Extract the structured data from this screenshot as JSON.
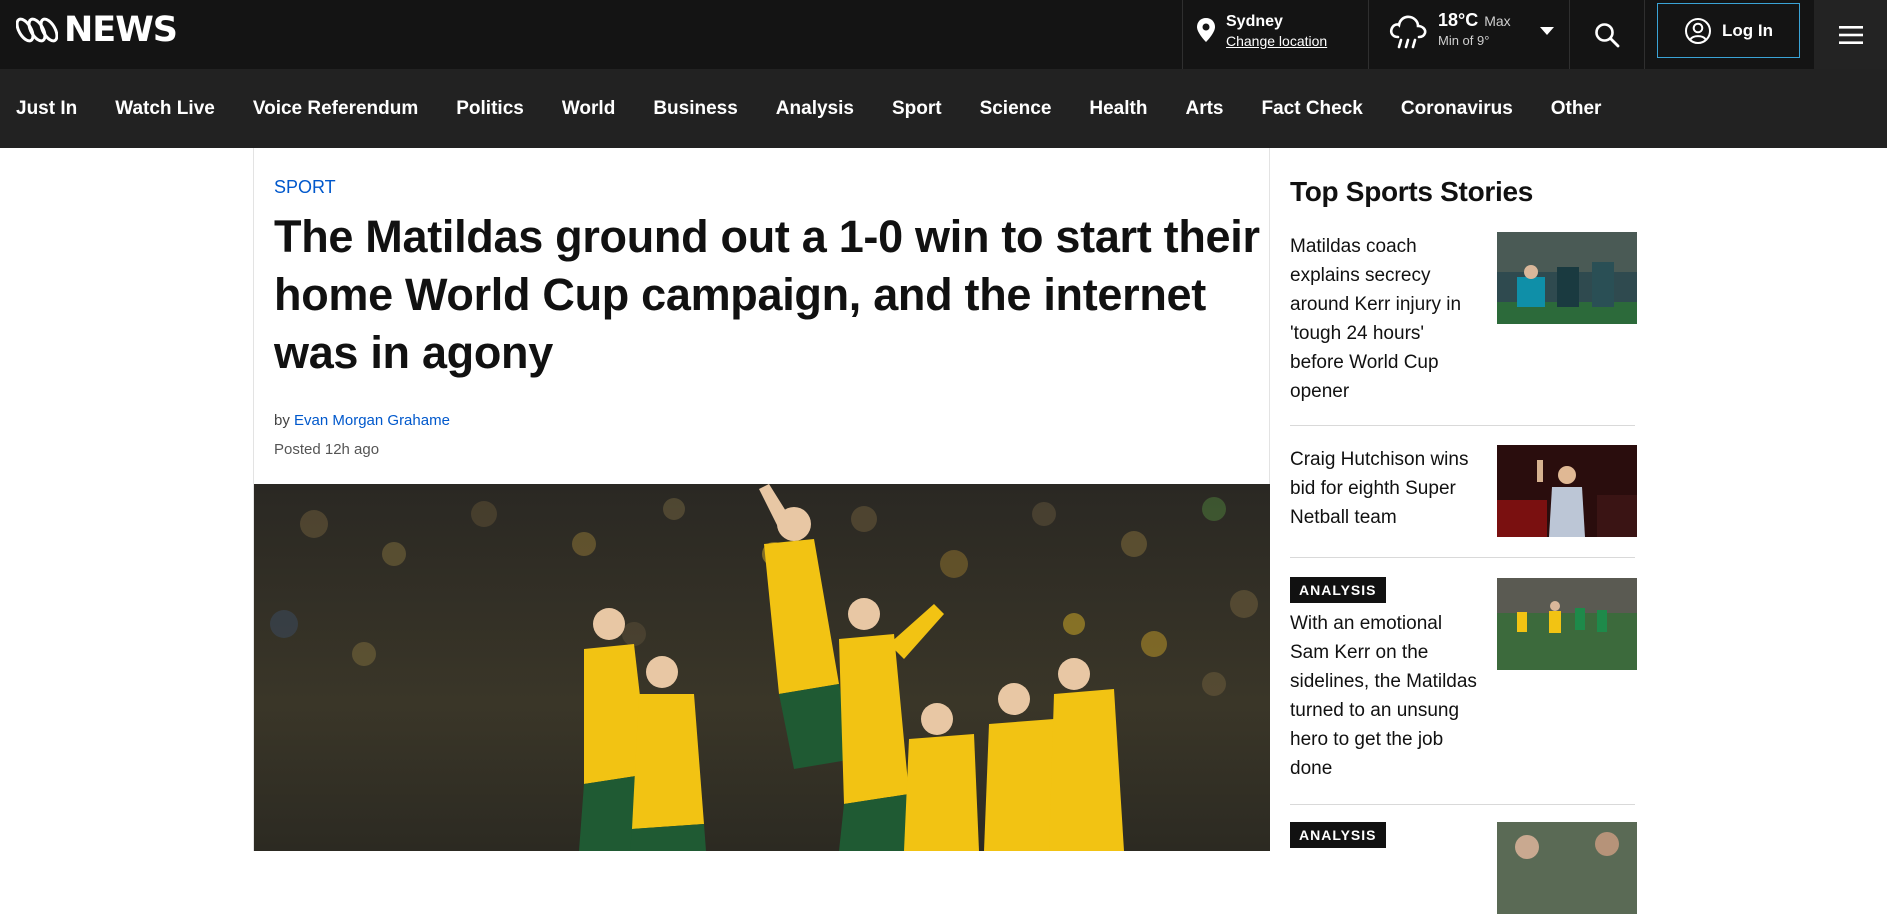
{
  "header": {
    "logo_text": "NEWS",
    "location": {
      "city": "Sydney",
      "change_label": "Change location"
    },
    "weather": {
      "temp": "18°C",
      "max_label": "Max",
      "min_label": "Min of 9°"
    },
    "login_label": "Log In"
  },
  "nav": {
    "items": [
      "Just In",
      "Watch Live",
      "Voice Referendum",
      "Politics",
      "World",
      "Business",
      "Analysis",
      "Sport",
      "Science",
      "Health",
      "Arts",
      "Fact Check",
      "Coronavirus",
      "Other"
    ]
  },
  "article": {
    "kicker": "SPORT",
    "headline": "The Matildas ground out a 1-0 win to start their home World Cup campaign, and the internet was in agony",
    "byline_prefix": "by",
    "author": "Evan Morgan Grahame",
    "posted": "Posted 12h ago"
  },
  "sidebar": {
    "title": "Top Sports Stories",
    "stories": [
      {
        "badge": "",
        "title": "Matildas coach explains secrecy around Kerr injury in 'tough 24 hours' before World Cup opener"
      },
      {
        "badge": "",
        "title": "Craig Hutchison wins bid for eighth Super Netball team"
      },
      {
        "badge": "ANALYSIS",
        "title": "With an emotional Sam Kerr on the sidelines, the Matildas turned to an unsung hero to get the job done"
      },
      {
        "badge": "ANALYSIS",
        "title": ""
      }
    ]
  },
  "colors": {
    "topbar": "#141414",
    "nav": "#222222",
    "link_blue": "#0058cc",
    "login_border": "#3aa3d6",
    "matildas_gold": "#f2c313",
    "matildas_green": "#1f5a33"
  }
}
